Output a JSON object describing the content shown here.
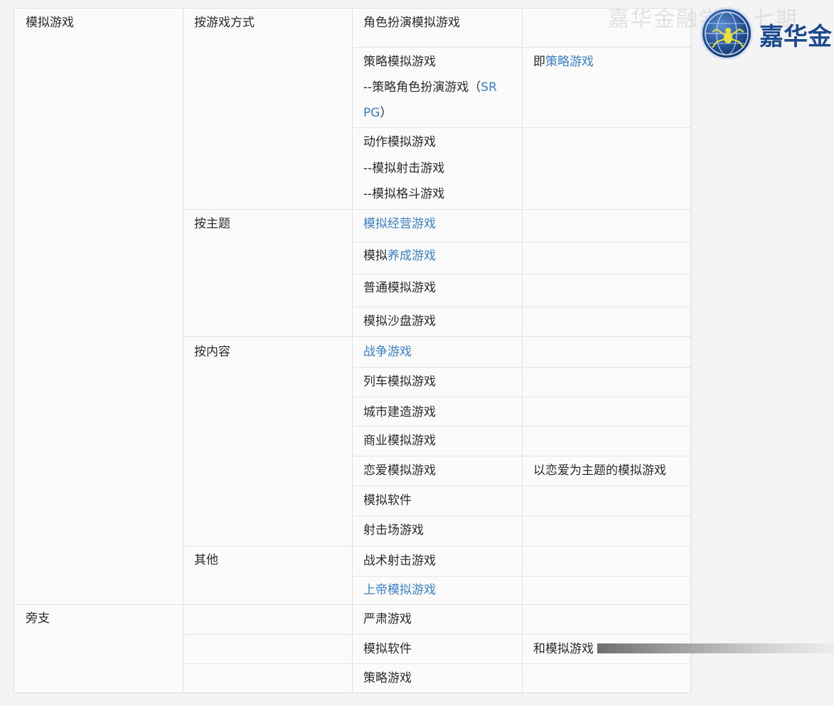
{
  "rows": {
    "sim": "模拟游戏",
    "side": "旁支"
  },
  "groups": {
    "mode": "按游戏方式",
    "theme": "按主题",
    "content": "按内容",
    "other": "其他"
  },
  "items": {
    "rpg_sim": "角色扮演模拟游戏",
    "strategy_l1": "策略模拟游戏",
    "strategy_l2": "--策略角色扮演游戏（",
    "strategy_l2_link": "SR",
    "strategy_l3_link": "PG",
    "strategy_l3": "）",
    "strategy_note_prefix": "即",
    "strategy_note_link": "策略游戏",
    "action_l1": "动作模拟游戏",
    "action_l2": "--模拟射击游戏",
    "action_l3": "--模拟格斗游戏",
    "business": "模拟经营游戏",
    "raise_prefix": "模拟",
    "raise_link": "养成游戏",
    "normal": "普通模拟游戏",
    "sandbox": "模拟沙盘游戏",
    "war": "战争游戏",
    "train": "列车模拟游戏",
    "city": "城市建造游戏",
    "commerce": "商业模拟游戏",
    "romance": "恋爱模拟游戏",
    "romance_note": "以恋爱为主题的模拟游戏",
    "software": "模拟软件",
    "range": "射击场游戏",
    "tactical": "战术射击游戏",
    "god": "上帝模拟游戏",
    "serious": "严肃游戏",
    "software2": "模拟软件",
    "software2_note": "和模拟游戏",
    "strategy_game": "策略游戏"
  },
  "watermark": {
    "ghost_text": "嘉华金融学堂 七期",
    "brand_text": "嘉华金",
    "logo_icon": "globe-spider-logo"
  },
  "colors": {
    "link": "#3a7fc4",
    "text": "#2b2b2b",
    "border": "#dcdcdc",
    "brand": "#1d4a8f"
  }
}
